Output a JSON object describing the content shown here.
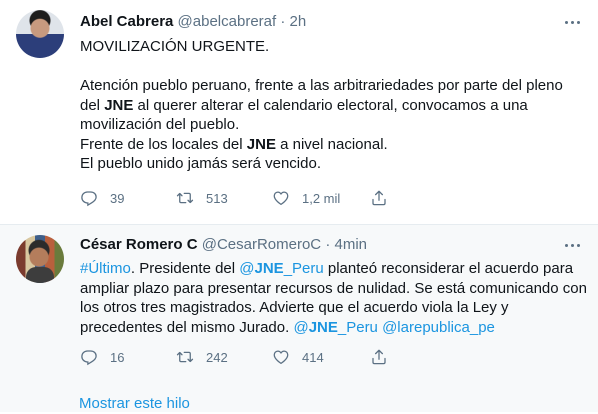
{
  "tweets": [
    {
      "name": "Abel Cabrera",
      "handle": "@abelcabreraf",
      "dot": "·",
      "time": "2h",
      "lines": {
        "l1": "MOVILIZACIÓN URGENTE.",
        "l2": "Atención pueblo peruano, frente a las arbitrariedades por parte del pleno",
        "l3a": "del ",
        "l3b": "JNE",
        "l3c": " al querer alterar el calendario electoral, convocamos a una",
        "l4": "movilización del pueblo.",
        "l5a": "Frente de los locales del ",
        "l5b": "JNE",
        "l5c": " a nivel nacional.",
        "l6": "El pueblo unido jamás será vencido."
      },
      "replies": "39",
      "retweets": "513",
      "likes": "1,2 mil"
    },
    {
      "name": "César Romero C",
      "handle": "@CesarRomeroC",
      "dot": "·",
      "time": "4min",
      "lines": {
        "l1a": "#Último",
        "l1b": ". Presidente del ",
        "l1c": "@",
        "l1d": "JNE",
        "l1e": "_Peru",
        "l1f": " planteó reconsiderar el acuerdo para",
        "l2": "ampliar plazo para presentar recursos de nulidad. Se está comunicando con",
        "l3": "los otros tres magistrados. Advierte que el acuerdo viola la Ley y",
        "l4a": "precedentes del mismo Jurado. ",
        "l4b": "@",
        "l4c": "JNE",
        "l4d": "_Peru",
        "l4e": " @larepublica_pe"
      },
      "replies": "16",
      "retweets": "242",
      "likes": "414",
      "thread_link": "Mostrar este hilo"
    }
  ],
  "icons": {
    "reply": "reply-icon",
    "retweet": "retweet-icon",
    "like": "heart-icon",
    "share": "share-icon",
    "more": "more-icon"
  },
  "colors": {
    "link": "#1b95e0",
    "muted": "#5b7083",
    "text": "#0f1419",
    "highlight_bg": "#f7f9fa"
  }
}
